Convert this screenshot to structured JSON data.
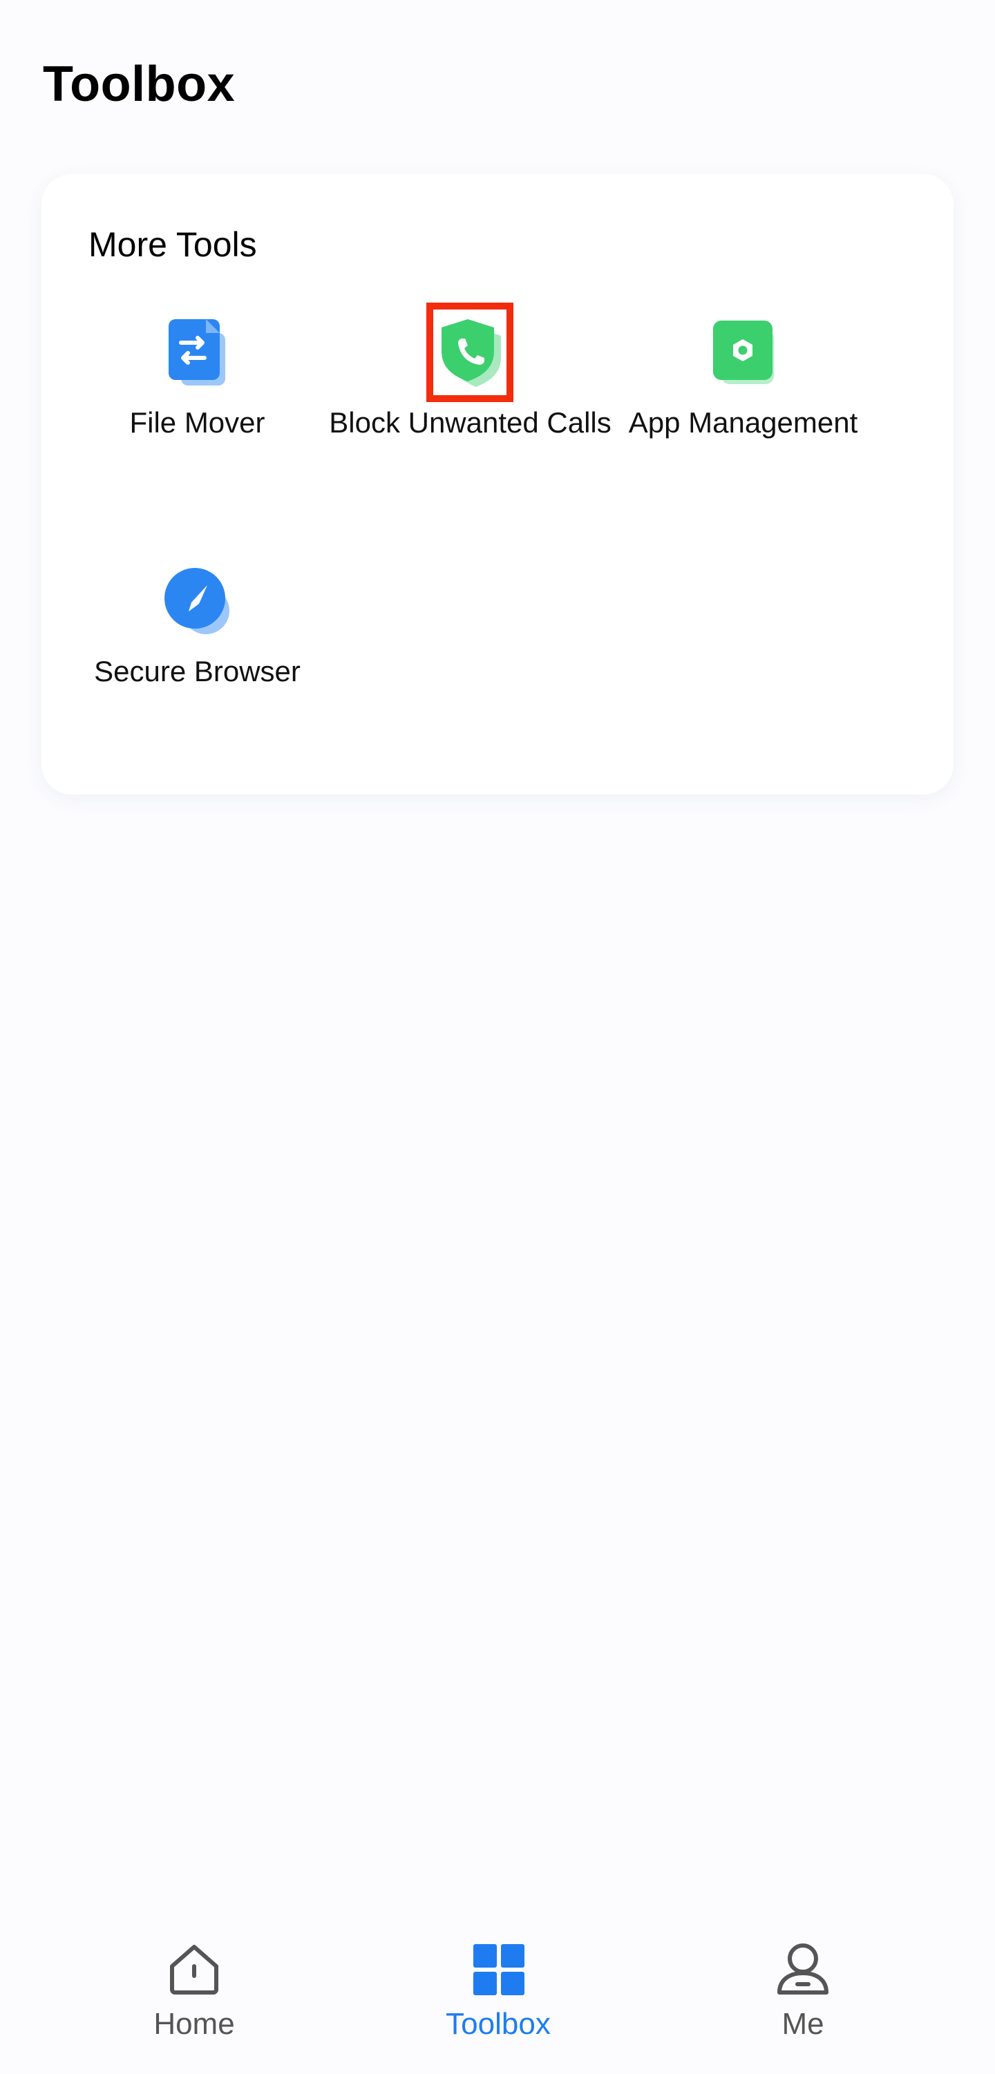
{
  "header": {
    "title": "Toolbox"
  },
  "more_tools": {
    "title": "More Tools",
    "items": [
      {
        "label": "File Mover",
        "icon": "file-mover-icon"
      },
      {
        "label": "Block Unwanted Calls",
        "icon": "call-shield-icon"
      },
      {
        "label": "App Management",
        "icon": "app-management-icon"
      },
      {
        "label": "Secure Browser",
        "icon": "compass-icon"
      }
    ]
  },
  "bottom_nav": {
    "items": [
      {
        "label": "Home",
        "icon": "home-icon",
        "active": false
      },
      {
        "label": "Toolbox",
        "icon": "grid-icon",
        "active": true
      },
      {
        "label": "Me",
        "icon": "person-icon",
        "active": false
      }
    ]
  },
  "colors": {
    "accent": "#1e7cf0",
    "highlight": "#f22c0d",
    "green": "#3ccf6e",
    "blue": "#2b86f2"
  }
}
